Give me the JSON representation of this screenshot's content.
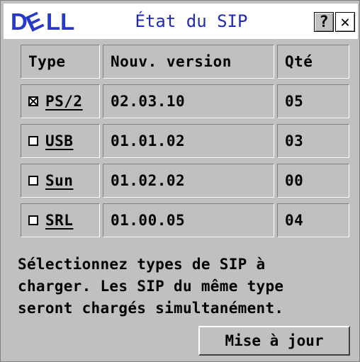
{
  "window": {
    "logo_text": "DELL",
    "title": "État du SIP",
    "help_label": "?",
    "close_label": "✕"
  },
  "table": {
    "headers": [
      "Type",
      "Nouv. version",
      "Qté"
    ],
    "rows": [
      {
        "type": "PS/2",
        "checked": true,
        "version": "02.03.10",
        "qty": "05"
      },
      {
        "type": "USB",
        "checked": false,
        "version": "01.01.02",
        "qty": "03"
      },
      {
        "type": "Sun",
        "checked": false,
        "version": "01.02.02",
        "qty": "00"
      },
      {
        "type": "SRL",
        "checked": false,
        "version": "01.00.05",
        "qty": "04"
      }
    ]
  },
  "message": "Sélectionnez types de SIP à\ncharger. Les SIP du même type\nseront chargés simultanément.",
  "update_button": "Mise à jour",
  "colors": {
    "background": "#c0c0c0",
    "title": "#202bb8",
    "logo": "#2838c8"
  }
}
